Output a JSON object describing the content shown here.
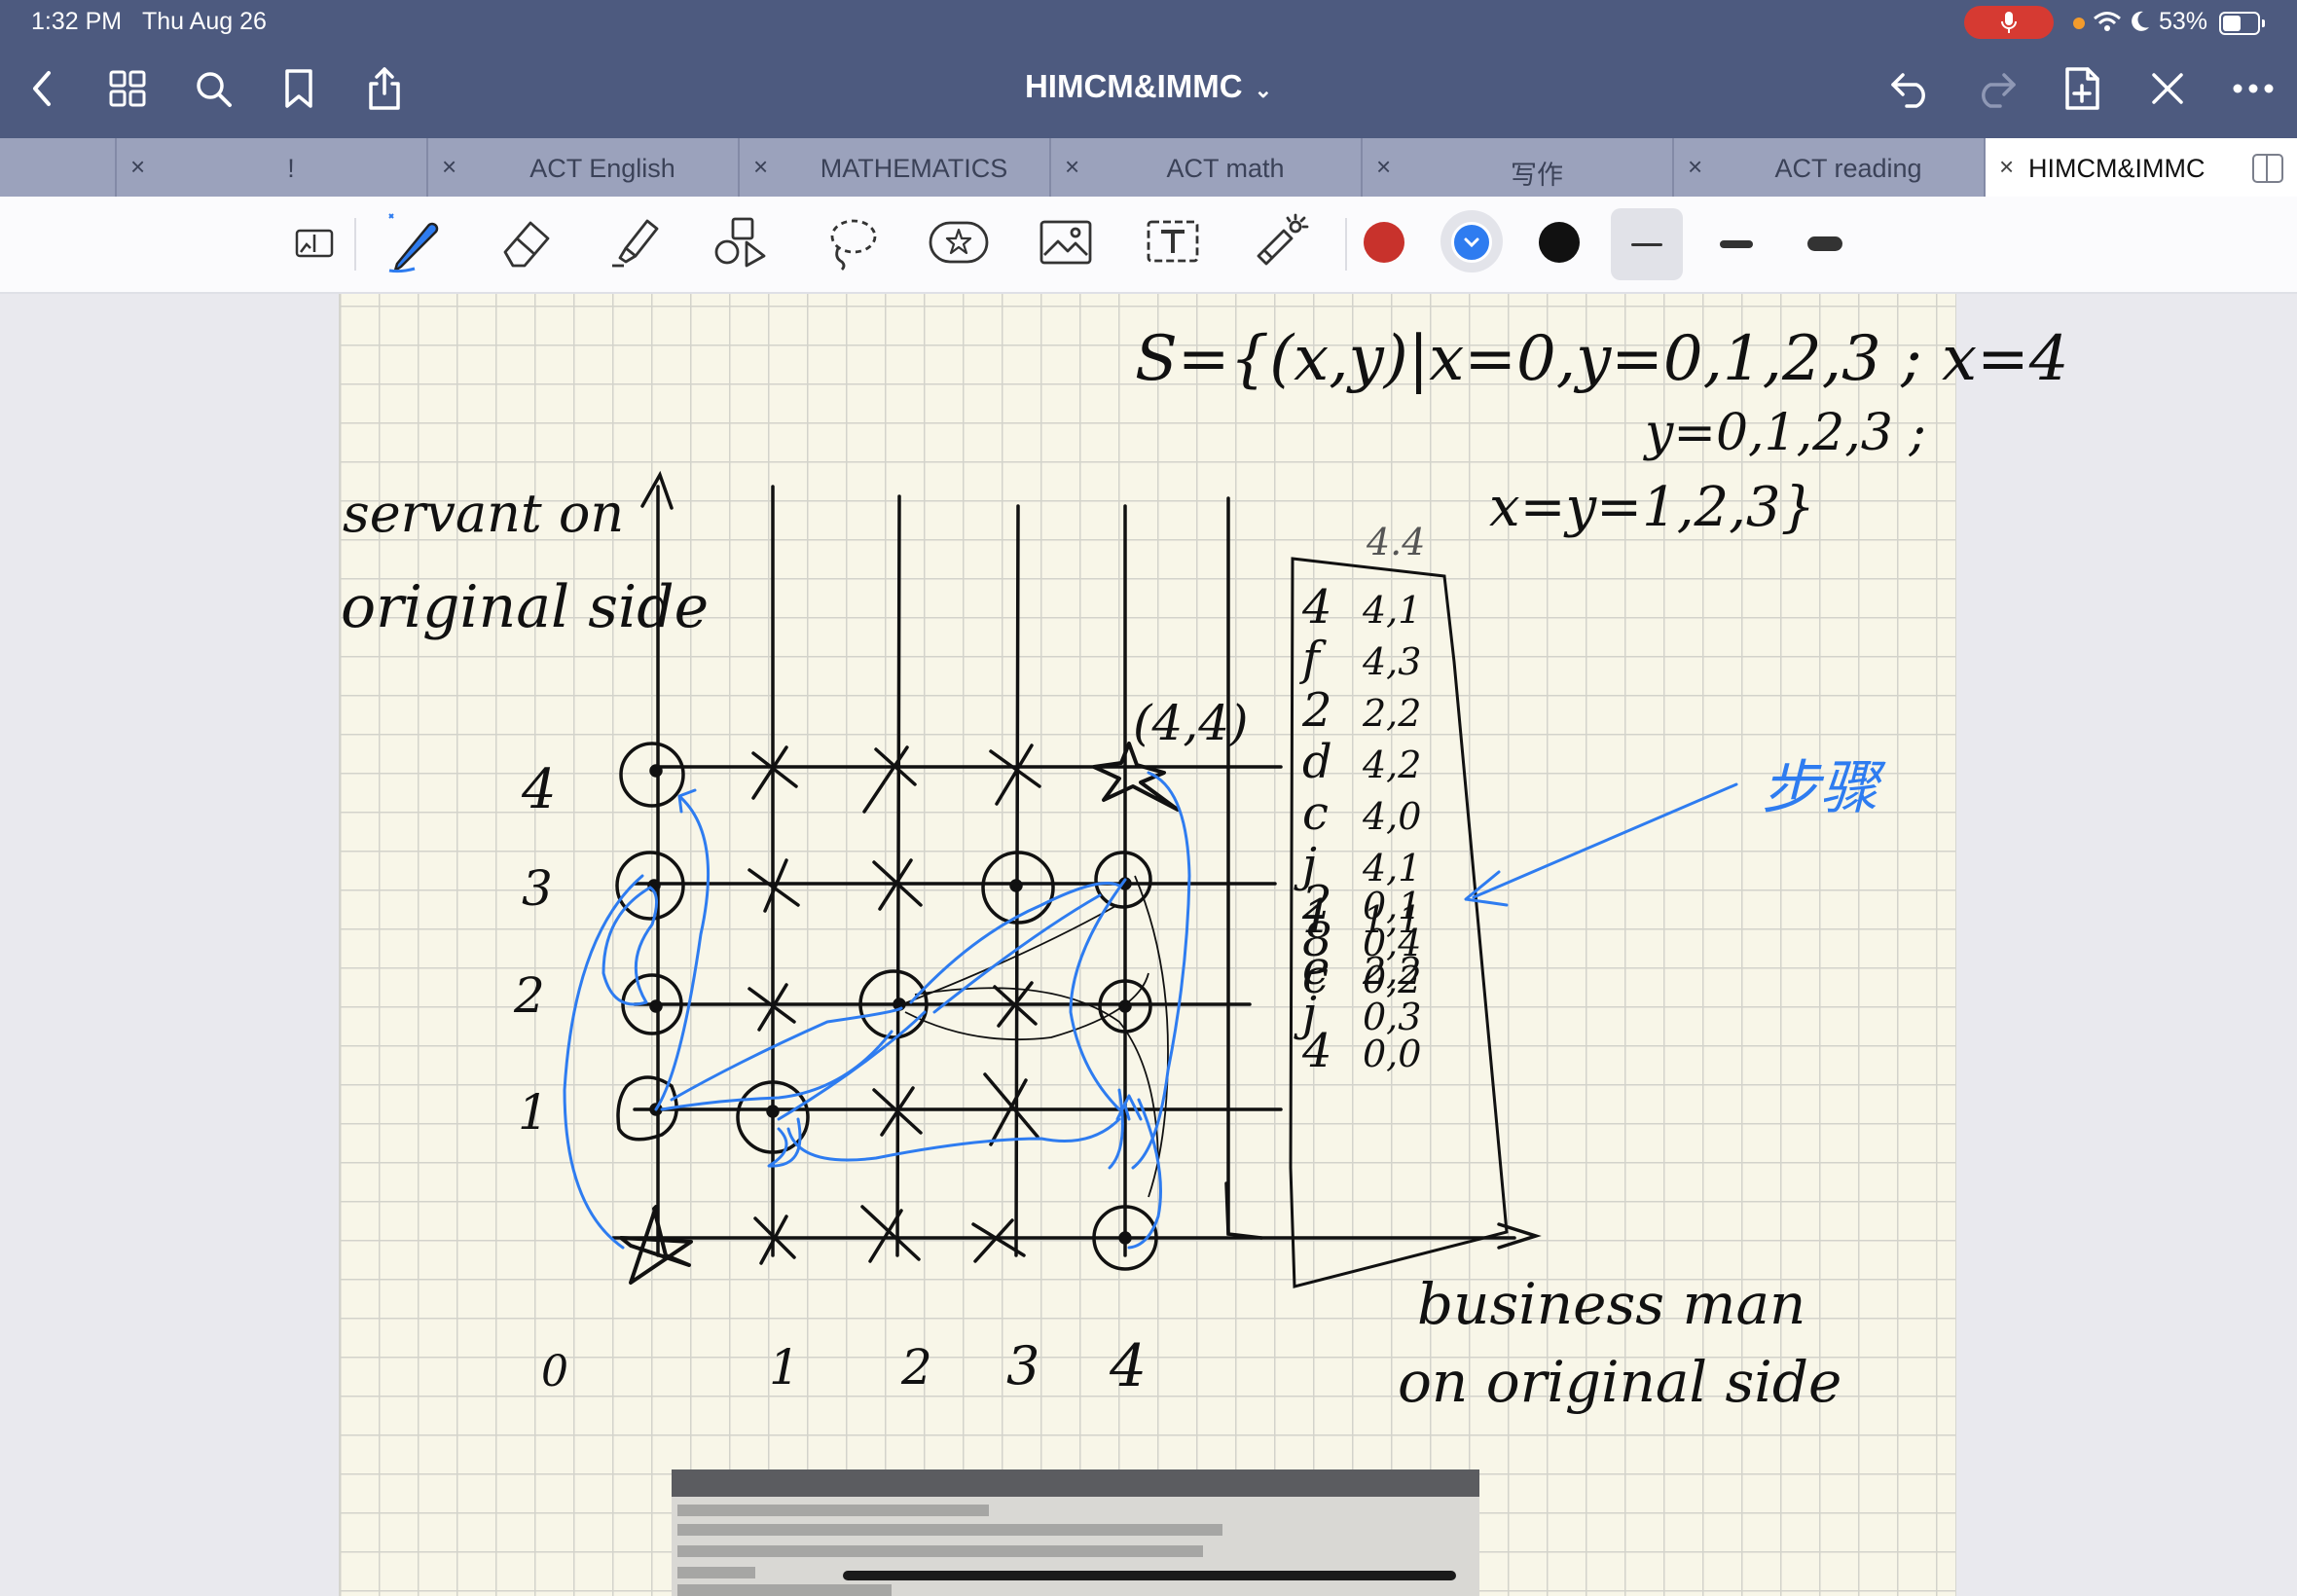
{
  "status_bar": {
    "time": "1:32 PM",
    "date": "Thu Aug 26",
    "battery": "53%"
  },
  "nav": {
    "title": "HIMCM&IMMC",
    "title_chevron": "⌄"
  },
  "tabs": [
    {
      "label": "!",
      "active": false
    },
    {
      "label": "ACT English",
      "active": false
    },
    {
      "label": "MATHEMATICS",
      "active": false
    },
    {
      "label": "ACT math",
      "active": false
    },
    {
      "label": "写作",
      "active": false
    },
    {
      "label": "ACT reading",
      "active": false
    },
    {
      "label": "HIMCM&IMMC",
      "active": true
    }
  ],
  "tab_close_glyph": "×",
  "colors": {
    "red": "#c8322c",
    "blue_selected": "#2e7cf0",
    "black": "#111111",
    "bar": "#4d5a7f"
  },
  "icons": [
    "back-icon",
    "grid-icon",
    "search-icon",
    "bookmark-icon",
    "share-icon",
    "undo-icon",
    "redo-icon",
    "add-page-icon",
    "close-pen-icon",
    "more-icon",
    "page-layout-icon",
    "pen-icon",
    "eraser-icon",
    "highlighter-icon",
    "shapes-icon",
    "lasso-icon",
    "sticker-icon",
    "image-icon",
    "text-icon",
    "laser-icon"
  ],
  "note": {
    "set_line1": "S={(x,y)|x=0,y=0,1,2,3 ; x=4",
    "set_line2": "y=0,1,2,3 ;",
    "set_line3": "x=y=1,2,3}",
    "y_label_1": "servant on",
    "y_label_2": "original side",
    "x_label_1": "business man",
    "x_label_2": "on original side",
    "corner_label": "(4,4)",
    "y_ticks": [
      "4",
      "3",
      "2",
      "1"
    ],
    "x_ticks": [
      "0",
      "1",
      "2",
      "3",
      "4"
    ],
    "table_header": "4.4",
    "table_rows": [
      [
        "4",
        "4,1"
      ],
      [
        "f",
        "4,3"
      ],
      [
        "2",
        "2,2"
      ],
      [
        "d",
        "4,2"
      ],
      [
        "c",
        "4,0"
      ],
      [
        "j",
        "4,1"
      ],
      [
        "1",
        "1,1"
      ],
      [
        "e",
        "2,2"
      ],
      [
        "2",
        "0,1"
      ],
      [
        "8",
        "0,4"
      ],
      [
        "c",
        "0,2"
      ],
      [
        "j",
        "0,3"
      ],
      [
        "4",
        "0,0"
      ]
    ],
    "step_label": "步骤"
  }
}
